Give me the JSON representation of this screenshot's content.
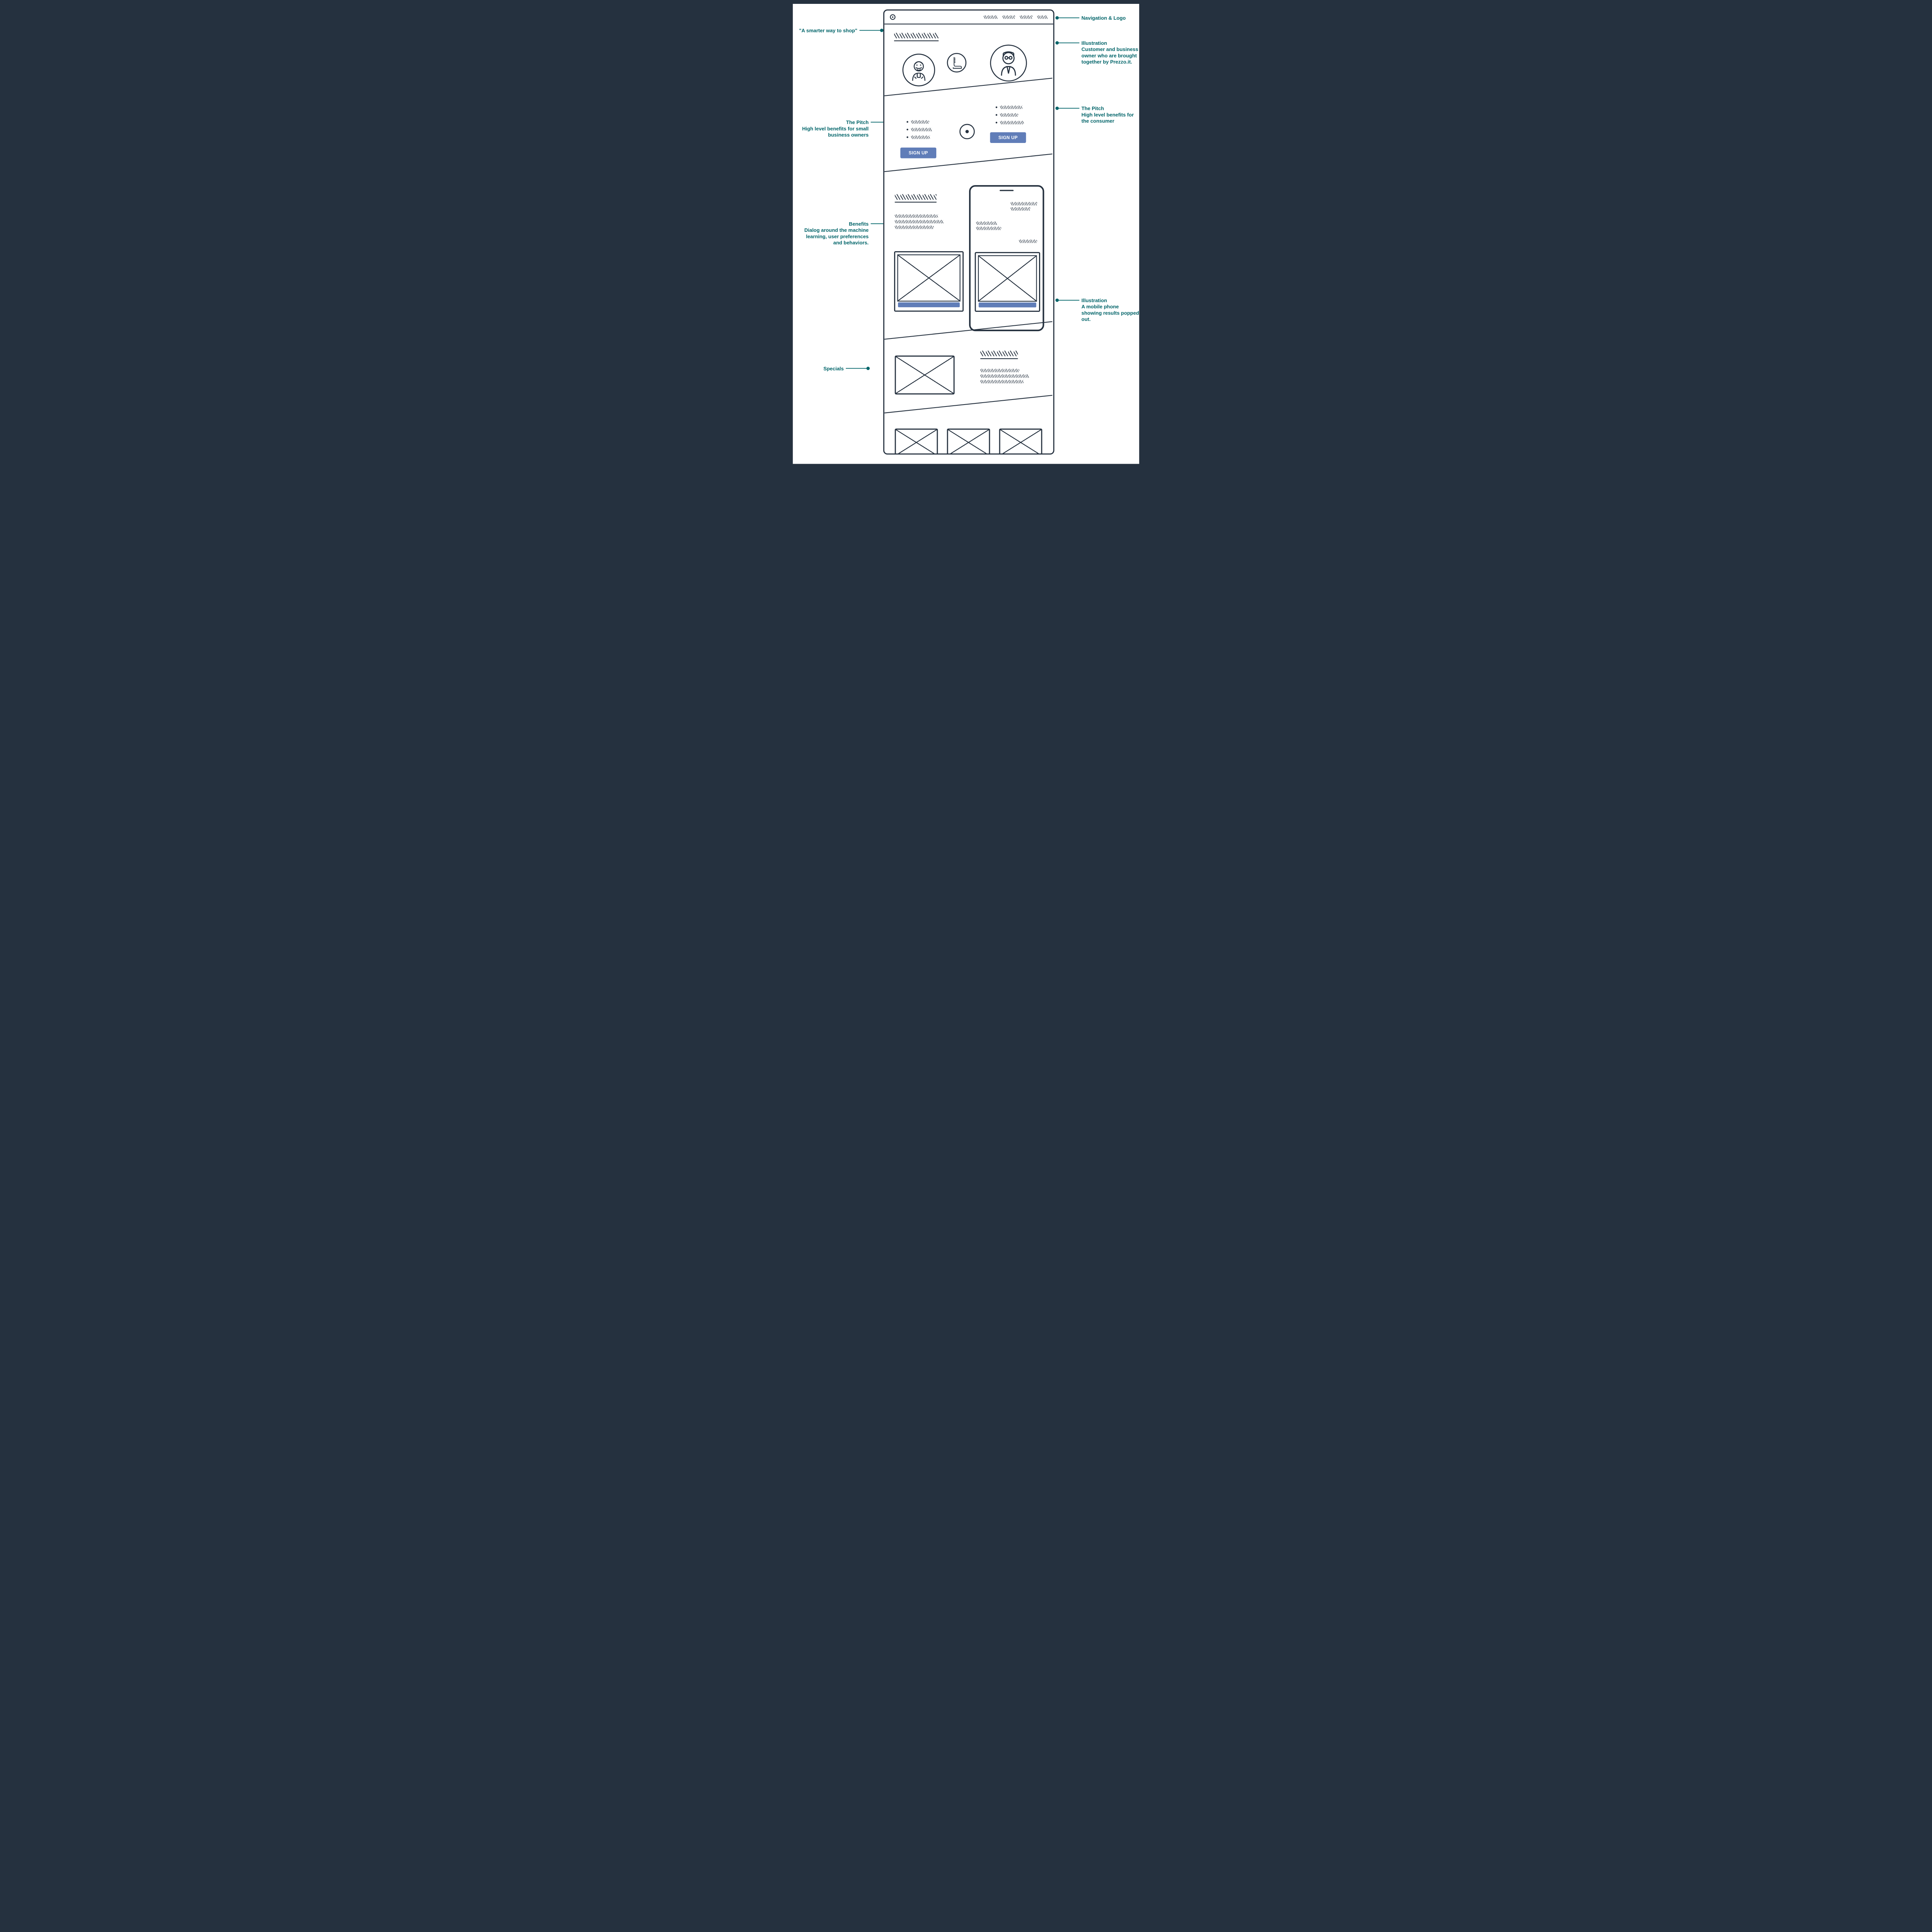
{
  "annotations": {
    "tagline": "\"A smarter way to shop\"",
    "navLogo": "Navigation & Logo",
    "heroIllo": "Illustration\nCustomer and business owner who are brought together by Prezzo.it.",
    "pitchLeft": "The Pitch\nHigh level benefits for small business owners",
    "pitchRight": "The Pitch\nHigh level benefits for the consumer",
    "benefits": "Benefits\nDialog around the machine learning, user preferences and behaviors.",
    "phoneIllo": "Illustration\nA mobile phone showing results popped out.",
    "specials": "Specials"
  },
  "buttons": {
    "signupBusiness": "SIGN UP",
    "signupConsumer": "SIGN UP"
  }
}
